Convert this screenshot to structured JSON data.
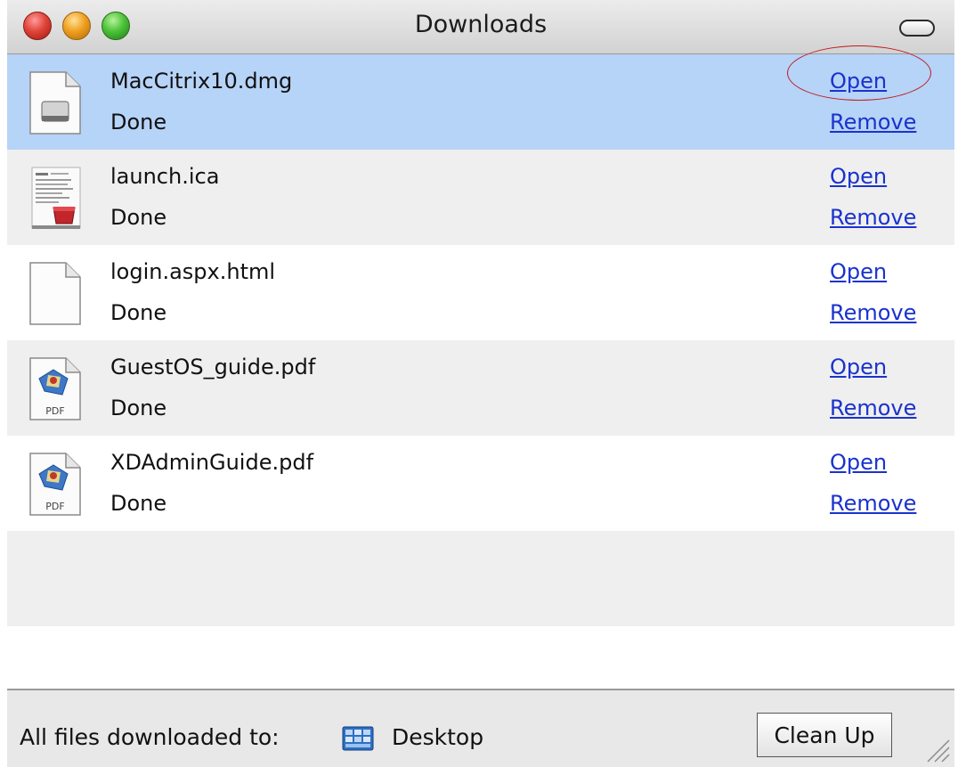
{
  "window": {
    "title": "Downloads",
    "colors": {
      "selected_row": "#b6d3f8",
      "link": "#1a33cc",
      "annotation": "#c21a1a"
    }
  },
  "downloads": [
    {
      "name": "MacCitrix10.dmg",
      "status": "Done",
      "open_label": "Open",
      "remove_label": "Remove",
      "icon": "disk-image-icon",
      "selected": true
    },
    {
      "name": "launch.ica",
      "status": "Done",
      "open_label": "Open",
      "remove_label": "Remove",
      "icon": "ica-document-icon",
      "selected": false
    },
    {
      "name": "login.aspx.html",
      "status": "Done",
      "open_label": "Open",
      "remove_label": "Remove",
      "icon": "blank-document-icon",
      "selected": false
    },
    {
      "name": "GuestOS_guide.pdf",
      "status": "Done",
      "open_label": "Open",
      "remove_label": "Remove",
      "icon": "pdf-document-icon",
      "icon_caption": "PDF",
      "selected": false
    },
    {
      "name": "XDAdminGuide.pdf",
      "status": "Done",
      "open_label": "Open",
      "remove_label": "Remove",
      "icon": "pdf-document-icon",
      "icon_caption": "PDF",
      "selected": false
    }
  ],
  "footer": {
    "label": "All files downloaded to:",
    "destination": "Desktop",
    "destination_icon": "desktop-folder-icon",
    "cleanup_label": "Clean Up"
  }
}
